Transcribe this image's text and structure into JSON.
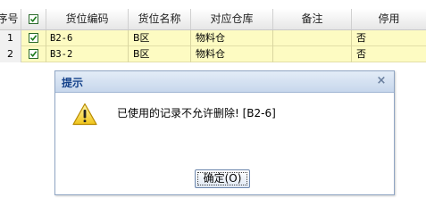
{
  "grid": {
    "columns": [
      "序号",
      "",
      "货位编码",
      "货位名称",
      "对应仓库",
      "备注",
      "停用"
    ],
    "rows": [
      {
        "index": "1",
        "checked": true,
        "code": "B2-6",
        "name": "B区",
        "warehouse": "物料仓",
        "remark": "",
        "disabled": "否"
      },
      {
        "index": "2",
        "checked": true,
        "code": "B3-2",
        "name": "B区",
        "warehouse": "物料仓",
        "remark": "",
        "disabled": "否"
      }
    ],
    "header_checkbox_checked": true,
    "row_highlight_color": "#fdfbc2"
  },
  "dialog": {
    "title": "提示",
    "close_glyph": "×",
    "icon": "warning-icon",
    "message": "已使用的记录不允许删除! [B2-6]",
    "ok_label": "确定(O)",
    "title_color": "#15428b"
  }
}
